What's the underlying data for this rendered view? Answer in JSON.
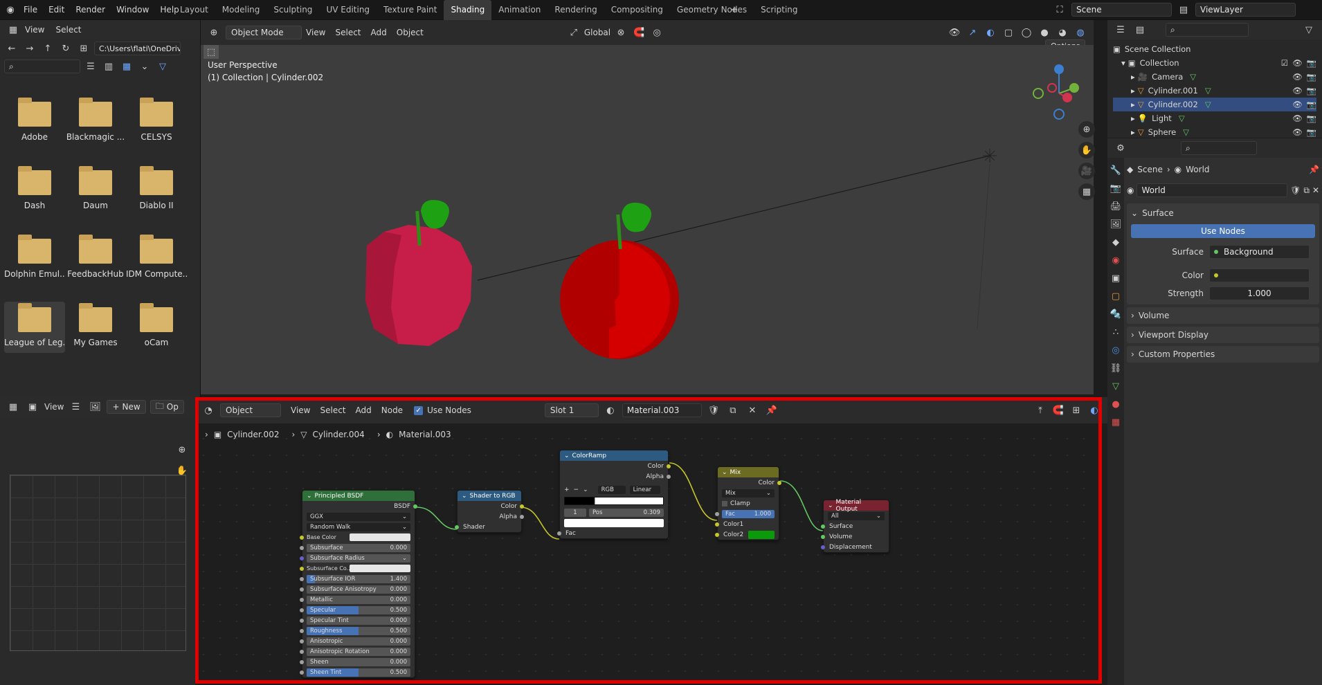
{
  "menu": [
    "File",
    "Edit",
    "Render",
    "Window",
    "Help"
  ],
  "workspaces": [
    "Layout",
    "Modeling",
    "Sculpting",
    "UV Editing",
    "Texture Paint",
    "Shading",
    "Animation",
    "Rendering",
    "Compositing",
    "Geometry Nodes",
    "Scripting"
  ],
  "active_workspace": "Shading",
  "scene": "Scene",
  "view_layer": "ViewLayer",
  "file_browser": {
    "menu": [
      "View",
      "Select"
    ],
    "path": "C:\\Users\\flati\\OneDriv...",
    "folders": [
      "Adobe",
      "Blackmagic ...",
      "CELSYS",
      "Dash",
      "Daum",
      "Diablo II",
      "Dolphin Emul...",
      "FeedbackHub",
      "IDM Compute...",
      "League of Leg...",
      "My Games",
      "oCam"
    ]
  },
  "viewport": {
    "mode": "Object Mode",
    "menu": [
      "View",
      "Select",
      "Add",
      "Object"
    ],
    "transform": "Global",
    "options": "Options",
    "overlay_line1": "User Perspective",
    "overlay_line2": "(1) Collection | Cylinder.002"
  },
  "outliner": {
    "root": "Scene Collection",
    "collection": "Collection",
    "items": [
      "Camera",
      "Cylinder.001",
      "Cylinder.002",
      "Light",
      "Sphere"
    ]
  },
  "properties": {
    "breadcrumb": [
      "Scene",
      "World"
    ],
    "world_name": "World",
    "surface_panel": "Surface",
    "use_nodes": "Use Nodes",
    "surface_label": "Surface",
    "surface_value": "Background",
    "color_label": "Color",
    "strength_label": "Strength",
    "strength_value": "1.000",
    "panels": [
      "Volume",
      "Viewport Display",
      "Custom Properties"
    ]
  },
  "image_editor": {
    "view": "View",
    "new": "New",
    "open": "Op"
  },
  "node_editor": {
    "object": "Object",
    "menu": [
      "View",
      "Select",
      "Add",
      "Node"
    ],
    "use_nodes": "Use Nodes",
    "slot": "Slot 1",
    "material": "Material.003",
    "breadcrumb": [
      "Cylinder.002",
      "Cylinder.004",
      "Material.003"
    ]
  },
  "nodes": {
    "bsdf": {
      "title": "Principled BSDF",
      "out": "BSDF",
      "dist": "GGX",
      "sss": "Random Walk",
      "rows": [
        {
          "label": "Base Color",
          "value": "",
          "fill": 0,
          "color": true
        },
        {
          "label": "Subsurface",
          "value": "0.000",
          "fill": 0
        },
        {
          "label": "Subsurface Radius",
          "value": "",
          "fill": 0,
          "drop": true
        },
        {
          "label": "Subsurface Co...",
          "value": "",
          "fill": 0,
          "color": true
        },
        {
          "label": "Subsurface IOR",
          "value": "1.400",
          "fill": 0.08
        },
        {
          "label": "Subsurface Anisotropy",
          "value": "0.000",
          "fill": 0
        },
        {
          "label": "Metallic",
          "value": "0.000",
          "fill": 0
        },
        {
          "label": "Specular",
          "value": "0.500",
          "fill": 0.5
        },
        {
          "label": "Specular Tint",
          "value": "0.000",
          "fill": 0
        },
        {
          "label": "Roughness",
          "value": "0.500",
          "fill": 0.5
        },
        {
          "label": "Anisotropic",
          "value": "0.000",
          "fill": 0
        },
        {
          "label": "Anisotropic Rotation",
          "value": "0.000",
          "fill": 0
        },
        {
          "label": "Sheen",
          "value": "0.000",
          "fill": 0
        },
        {
          "label": "Sheen Tint",
          "value": "0.500",
          "fill": 0.5
        }
      ]
    },
    "s2rgb": {
      "title": "Shader to RGB",
      "out1": "Color",
      "out2": "Alpha",
      "in": "Shader"
    },
    "ramp": {
      "title": "ColorRamp",
      "out1": "Color",
      "out2": "Alpha",
      "mode": "RGB",
      "interp": "Linear",
      "index": "1",
      "pos_label": "Pos",
      "pos": "0.309",
      "in": "Fac"
    },
    "mix": {
      "title": "Mix",
      "out": "Color",
      "blend": "Mix",
      "clamp": "Clamp",
      "fac_label": "Fac",
      "fac": "1.000",
      "c1": "Color1",
      "c2": "Color2"
    },
    "output": {
      "title": "Material Output",
      "target": "All",
      "s1": "Surface",
      "s2": "Volume",
      "s3": "Displacement"
    }
  }
}
